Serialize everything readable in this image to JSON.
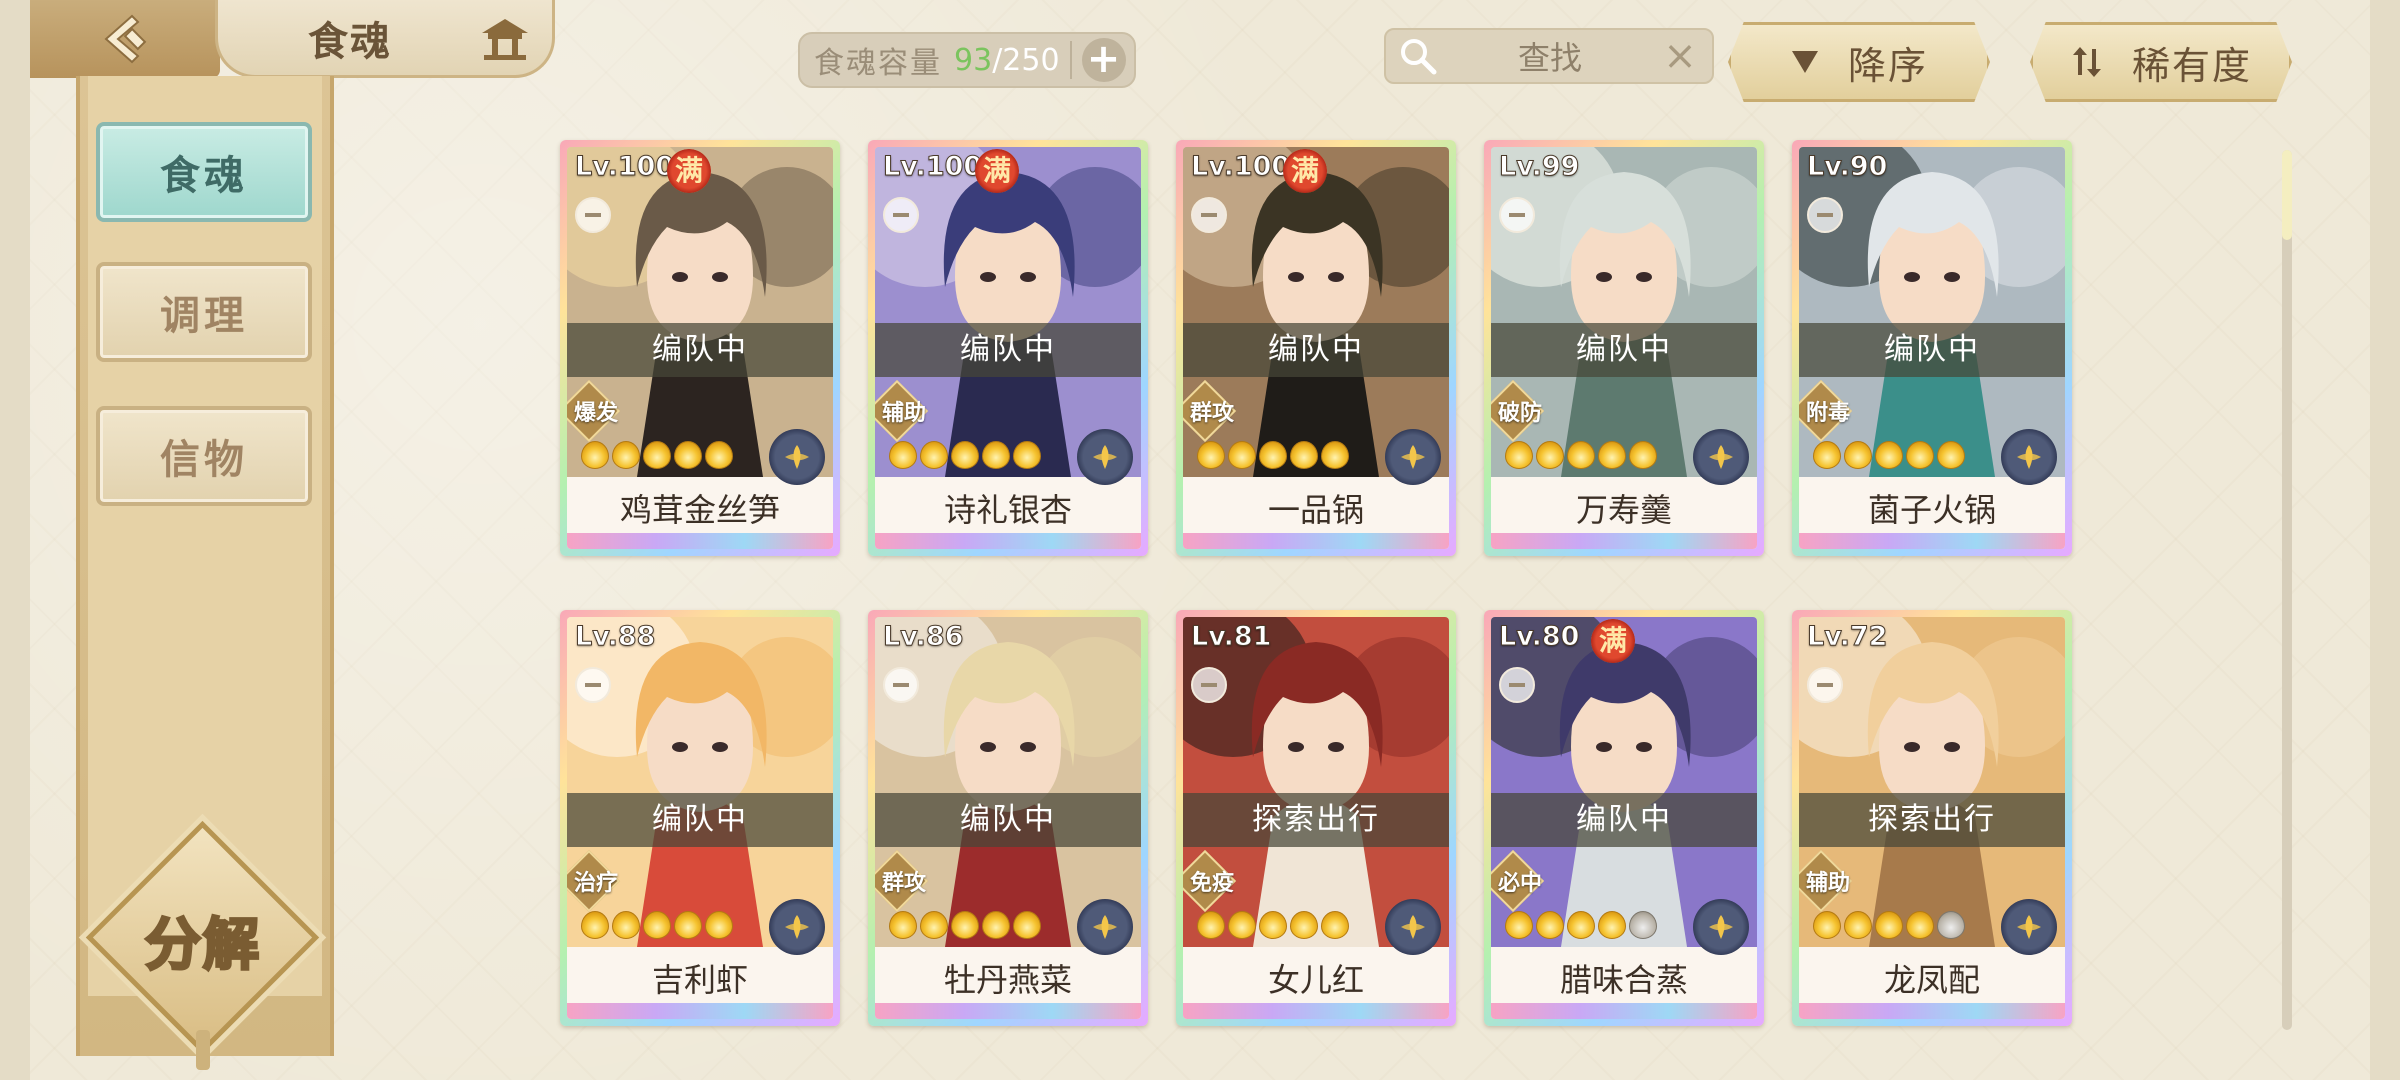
{
  "header": {
    "title": "食魂",
    "capacity_label": "食魂容量",
    "capacity_current": "93",
    "capacity_separator": "/",
    "capacity_max": "250",
    "search_placeholder": "查找",
    "sort_order_label": "降序",
    "sort_key_label": "稀有度"
  },
  "sidebar": {
    "tabs": [
      {
        "label": "食魂",
        "active": true
      },
      {
        "label": "调理",
        "active": false
      },
      {
        "label": "信物",
        "active": false
      }
    ],
    "decompose_label": "分解"
  },
  "cards": [
    {
      "level": "Lv.100",
      "full": "满",
      "status": "编队中",
      "role": "爆发",
      "stars": 5,
      "name": "鸡茸金丝笋",
      "palette": [
        "#6a5a48",
        "#c9b28f",
        "#f1d9a2",
        "#2c2420"
      ]
    },
    {
      "level": "Lv.100",
      "full": "满",
      "status": "编队中",
      "role": "辅助",
      "stars": 5,
      "name": "诗礼银杏",
      "palette": [
        "#3a3d7a",
        "#9c8fcf",
        "#d9cfe8",
        "#2a2a50"
      ]
    },
    {
      "level": "Lv.100",
      "full": "满",
      "status": "编队中",
      "role": "群攻",
      "stars": 5,
      "name": "一品锅",
      "palette": [
        "#3b3424",
        "#9c7b5a",
        "#d8c2a2",
        "#1f1c18"
      ]
    },
    {
      "level": "Lv.99",
      "full": "",
      "status": "编队中",
      "role": "破防",
      "stars": 5,
      "name": "万寿羹",
      "palette": [
        "#d7dfda",
        "#a9b7b4",
        "#eef1ea",
        "#5d7a6f"
      ]
    },
    {
      "level": "Lv.90",
      "full": "",
      "status": "编队中",
      "role": "附毒",
      "stars": 5,
      "name": "菌子火锅",
      "palette": [
        "#e1e6e9",
        "#aeb9c0",
        "#2e3a3a",
        "#3b8f8a"
      ]
    },
    {
      "level": "Lv.88",
      "full": "",
      "status": "编队中",
      "role": "治疗",
      "stars": 5,
      "name": "吉利虾",
      "palette": [
        "#f2b766",
        "#f7d49a",
        "#fff4e6",
        "#d84b3a"
      ]
    },
    {
      "level": "Lv.86",
      "full": "",
      "status": "编队中",
      "role": "群攻",
      "stars": 5,
      "name": "牡丹燕菜",
      "palette": [
        "#e8d7a8",
        "#d9c3a0",
        "#f3efe6",
        "#9c2c2c"
      ]
    },
    {
      "level": "Lv.81",
      "full": "",
      "status": "探索出行",
      "role": "免疫",
      "stars": 5,
      "name": "女儿红",
      "palette": [
        "#8a2a24",
        "#c24e3e",
        "#2b1d1a",
        "#f0e5d6"
      ]
    },
    {
      "level": "Lv.80",
      "full": "满",
      "status": "编队中",
      "role": "必中",
      "stars": 4,
      "name": "腊味合蒸",
      "palette": [
        "#3f3a6a",
        "#8a77c9",
        "#2a2f2c",
        "#d8dde0"
      ]
    },
    {
      "level": "Lv.72",
      "full": "",
      "status": "探索出行",
      "role": "辅助",
      "stars": 4,
      "name": "龙凤配",
      "palette": [
        "#f1cf9c",
        "#e6b979",
        "#f8efe0",
        "#a77a4b"
      ]
    }
  ],
  "colors": {
    "background": "#efe9d8",
    "sidebar": "#dcc495",
    "active_tab": "#9ed7cd",
    "capacity_current": "#7bc45e",
    "status_band": "#464637"
  },
  "icons": [
    "back-arrow-icon",
    "pagoda-home-icon",
    "plus-icon",
    "search-icon",
    "close-icon",
    "sort-down-icon",
    "sort-swap-icon",
    "skin-icon",
    "star-icon",
    "element-icon"
  ]
}
